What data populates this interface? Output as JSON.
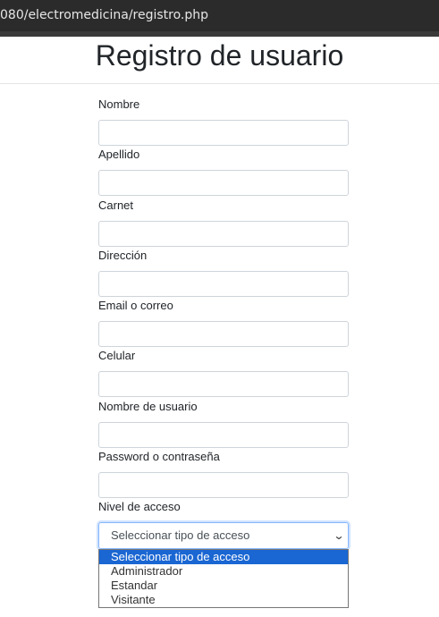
{
  "browser": {
    "url": "080/electromedicina/registro.php"
  },
  "page": {
    "title": "Registro de usuario"
  },
  "form": {
    "fields": [
      {
        "label": "Nombre",
        "value": ""
      },
      {
        "label": "Apellido",
        "value": ""
      },
      {
        "label": "Carnet",
        "value": ""
      },
      {
        "label": "Dirección",
        "value": ""
      },
      {
        "label": "Email o correo",
        "value": ""
      },
      {
        "label": "Celular",
        "value": ""
      },
      {
        "label": "Nombre de usuario",
        "value": ""
      },
      {
        "label": "Password o contraseña",
        "value": ""
      }
    ],
    "access": {
      "label": "Nivel de acceso",
      "selected": "Seleccionar tipo de acceso",
      "options": [
        "Seleccionar tipo de acceso",
        "Administrador",
        "Estandar",
        "Visitante"
      ]
    }
  },
  "colors": {
    "highlight": "#1a66d2",
    "urlbar": "#2b2b2b"
  }
}
